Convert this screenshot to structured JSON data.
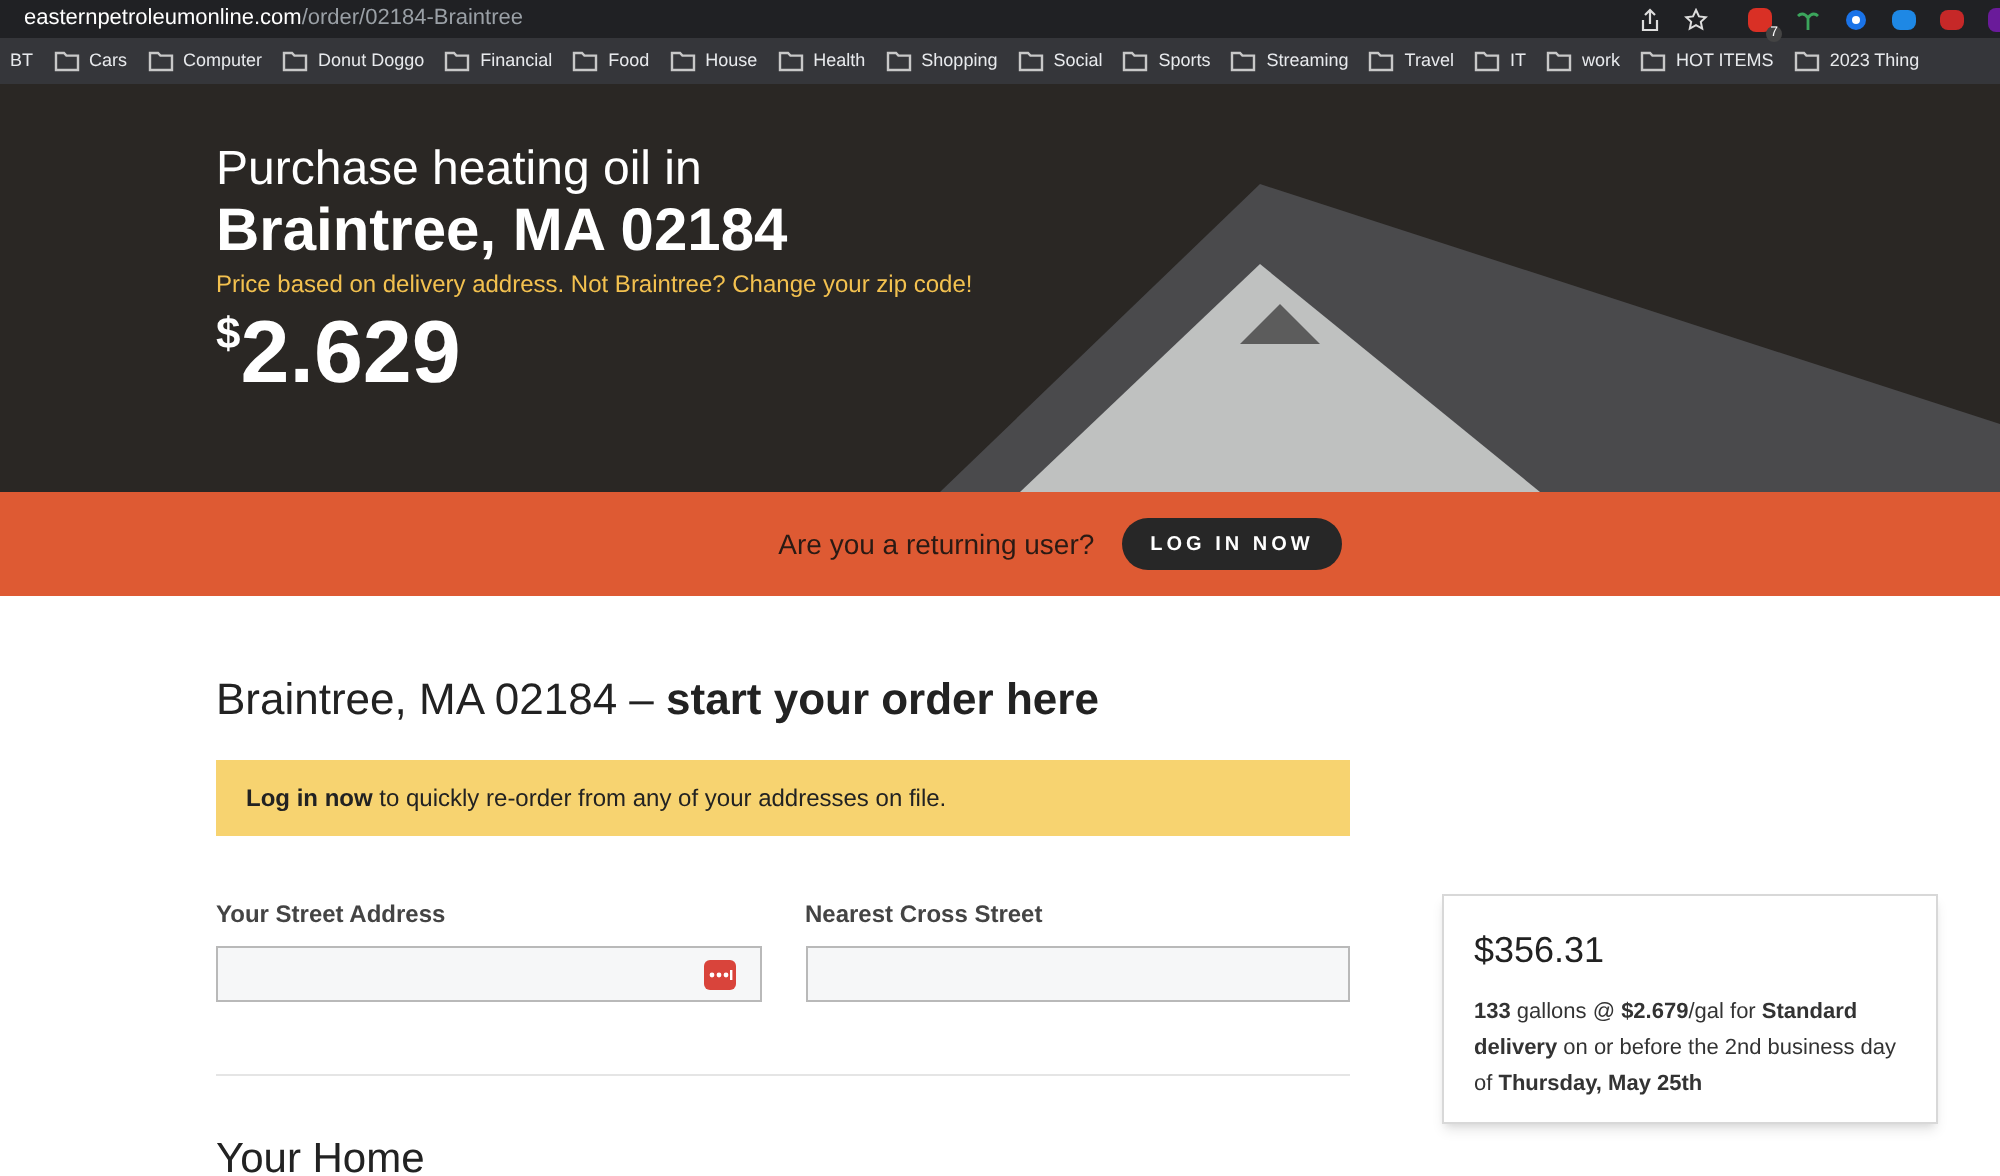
{
  "browser": {
    "url_domain": "easternpetroleumonline.com",
    "url_path": "/order/02184-Braintree",
    "extension_badge": "7"
  },
  "bookmarks": [
    {
      "label": "BT",
      "kind": "link"
    },
    {
      "label": "Cars",
      "kind": "folder"
    },
    {
      "label": "Computer",
      "kind": "folder"
    },
    {
      "label": "Donut Doggo",
      "kind": "folder"
    },
    {
      "label": "Financial",
      "kind": "folder"
    },
    {
      "label": "Food",
      "kind": "folder"
    },
    {
      "label": "House",
      "kind": "folder"
    },
    {
      "label": "Health",
      "kind": "folder"
    },
    {
      "label": "Shopping",
      "kind": "folder"
    },
    {
      "label": "Social",
      "kind": "folder"
    },
    {
      "label": "Sports",
      "kind": "folder"
    },
    {
      "label": "Streaming",
      "kind": "folder"
    },
    {
      "label": "Travel",
      "kind": "folder"
    },
    {
      "label": "IT",
      "kind": "folder"
    },
    {
      "label": "work",
      "kind": "folder"
    },
    {
      "label": "HOT ITEMS",
      "kind": "folder"
    },
    {
      "label": "2023 Thing",
      "kind": "folder"
    }
  ],
  "hero": {
    "intro": "Purchase heating oil in",
    "location": "Braintree, MA 02184",
    "note": "Price based on delivery address. Not Braintree? Change your zip code!",
    "price_currency": "$",
    "price_amount": "2.629"
  },
  "returning_bar": {
    "question": "Are you a returning user?",
    "button": "LOG IN NOW"
  },
  "order": {
    "heading": "Braintree, MA 02184 – **start your order here**",
    "banner": "**Log in now** to quickly re-order from any of your addresses on file.",
    "fields": [
      {
        "label": "Your Street Address",
        "autofill_icon": true
      },
      {
        "label": "Nearest Cross Street",
        "autofill_icon": false
      }
    ],
    "next_heading": "Your Home"
  },
  "summary": {
    "total": "$356.31",
    "details": "**133** gallons @ **$2.679**/gal for **Standard delivery** on or before the 2nd business day of **Thursday, May 25th**"
  }
}
